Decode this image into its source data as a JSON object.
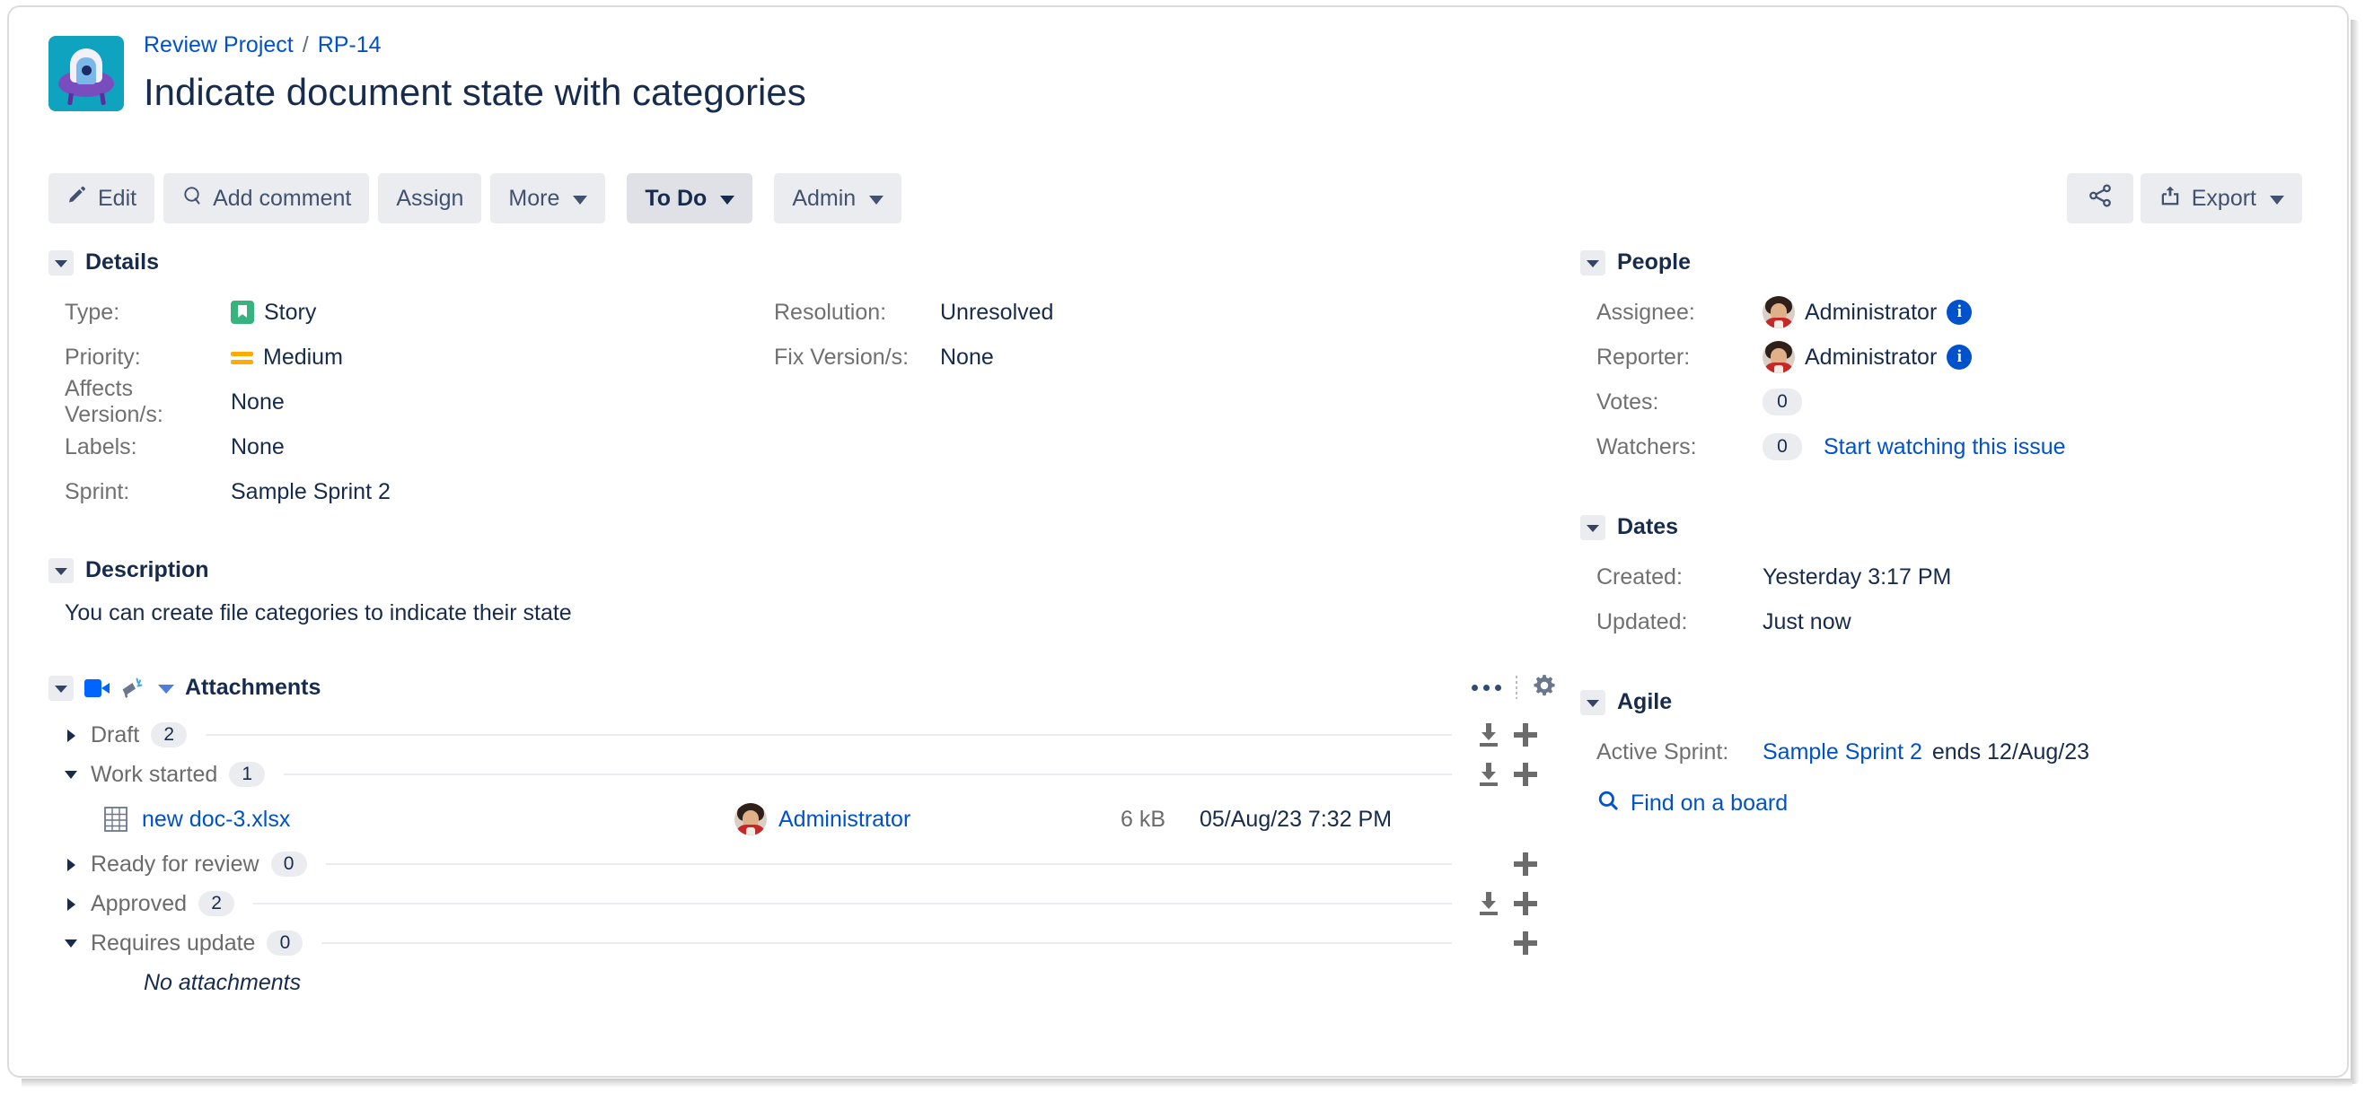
{
  "header": {
    "project_avatar_name": "project-avatar-ufo",
    "breadcrumb_project": "Review Project",
    "breadcrumb_separator": "/",
    "breadcrumb_issue_key": "RP-14",
    "issue_title": "Indicate document state with categories"
  },
  "toolbar": {
    "edit": "Edit",
    "add_comment": "Add comment",
    "assign": "Assign",
    "more": "More",
    "status": "To Do",
    "admin": "Admin",
    "export": "Export"
  },
  "details": {
    "title": "Details",
    "left_fields": [
      {
        "label": "Type:",
        "value": "Story",
        "icon": "story-icon"
      },
      {
        "label": "Priority:",
        "value": "Medium",
        "icon": "priority-medium-icon"
      },
      {
        "label": "Affects Version/s:",
        "value": "None",
        "icon": ""
      },
      {
        "label": "Labels:",
        "value": "None",
        "icon": ""
      },
      {
        "label": "Sprint:",
        "value": "Sample Sprint 2",
        "icon": ""
      }
    ],
    "right_fields": [
      {
        "label": "Resolution:",
        "value": "Unresolved"
      },
      {
        "label": "Fix Version/s:",
        "value": "None"
      }
    ]
  },
  "description": {
    "title": "Description",
    "body": "You can create file categories to indicate their state"
  },
  "attachments": {
    "title": "Attachments",
    "categories": [
      {
        "name": "Draft",
        "count": "2",
        "expanded": false,
        "has_download": true
      },
      {
        "name": "Work started",
        "count": "1",
        "expanded": true,
        "has_download": true
      },
      {
        "name": "Ready for review",
        "count": "0",
        "expanded": false,
        "has_download": false
      },
      {
        "name": "Approved",
        "count": "2",
        "expanded": false,
        "has_download": true
      },
      {
        "name": "Requires update",
        "count": "0",
        "expanded": true,
        "has_download": false
      }
    ],
    "file": {
      "name": "new doc-3.xlsx",
      "author": "Administrator",
      "size": "6 kB",
      "date": "05/Aug/23 7:32 PM"
    },
    "empty_text": "No attachments"
  },
  "people": {
    "title": "People",
    "assignee_label": "Assignee:",
    "assignee_name": "Administrator",
    "reporter_label": "Reporter:",
    "reporter_name": "Administrator",
    "votes_label": "Votes:",
    "votes_count": "0",
    "watchers_label": "Watchers:",
    "watchers_count": "0",
    "watch_link": "Start watching this issue"
  },
  "dates": {
    "title": "Dates",
    "created_label": "Created:",
    "created_value": "Yesterday 3:17 PM",
    "updated_label": "Updated:",
    "updated_value": "Just now"
  },
  "agile": {
    "title": "Agile",
    "active_sprint_label": "Active Sprint:",
    "sprint_link": "Sample Sprint 2",
    "sprint_suffix": "ends 12/Aug/23",
    "find_board": "Find on a board"
  },
  "colors": {
    "link": "#0052CC",
    "text": "#172B4D",
    "muted": "#707070",
    "button_bg": "#EBECF0",
    "status_bg": "#DFE1E6",
    "story_green": "#36B37E",
    "priority_orange": "#FFAB00",
    "avatar_teal": "#0FA3BF",
    "avatar_purple": "#7A4DBF"
  }
}
